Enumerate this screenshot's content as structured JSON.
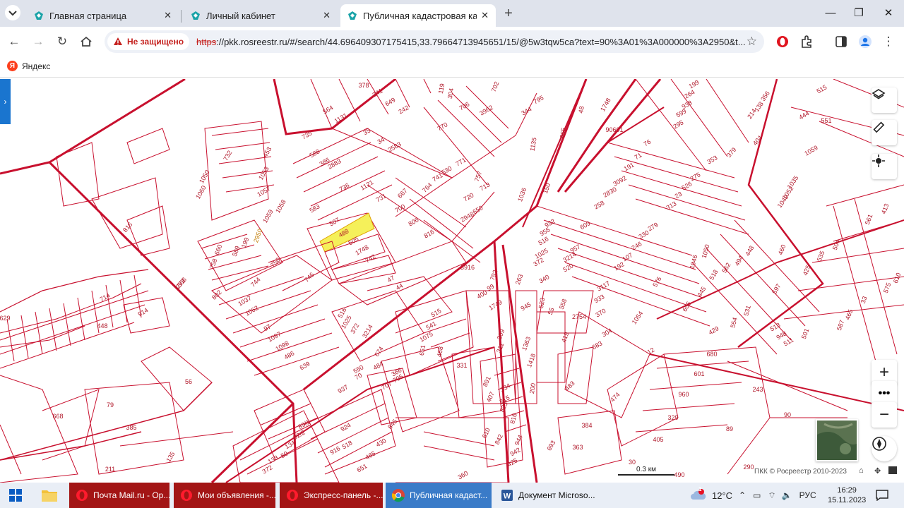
{
  "browser": {
    "tabs": [
      {
        "title": "Главная страница",
        "active": false
      },
      {
        "title": "Личный кабинет",
        "active": false
      },
      {
        "title": "Публичная кадастровая карта",
        "active": true
      }
    ],
    "new_tab_icon": "plus-icon",
    "security_label": "Не защищено",
    "url_scheme": "https",
    "url_rest": "://pkk.rosreestr.ru/#/search/44.696409307175415,33.79664713945651/15/@5w3tqw5ca?text=90%3A01%3A000000%3A2950&t...",
    "bookmark": "Яндекс"
  },
  "map": {
    "parcel_labels": [
      "378",
      "241",
      "649",
      "242",
      "35",
      "34",
      "2583",
      "1131",
      "386",
      "2883",
      "588",
      "735",
      "564",
      "119",
      "304",
      "706",
      "702",
      "3962",
      "770",
      "795",
      "344",
      "1135",
      "965",
      "48",
      "1748",
      "90601",
      "199",
      "264",
      "938",
      "599",
      "295",
      "353",
      "275",
      "526",
      "23",
      "313",
      "76",
      "71",
      "191",
      "3092",
      "2830",
      "258",
      "279",
      "330",
      "246",
      "107",
      "192",
      "3117",
      "933",
      "370",
      "1054",
      "1059",
      "1035",
      "1052",
      "1049",
      "404",
      "379",
      "214",
      "138",
      "356",
      "515",
      "444",
      "551",
      "561",
      "413",
      "504",
      "535",
      "425",
      "460",
      "448",
      "494",
      "562",
      "518",
      "445",
      "655",
      "1046",
      "1050",
      "597",
      "531",
      "554",
      "513",
      "948",
      "511",
      "429",
      "501",
      "587",
      "465",
      "33",
      "575",
      "610",
      "576",
      "453",
      "1053",
      "732",
      "1050",
      "1060",
      "1057",
      "1058",
      "1059",
      "583",
      "736",
      "1121",
      "731",
      "667",
      "700",
      "764",
      "741",
      "530",
      "771",
      "757",
      "713",
      "720",
      "650",
      "2948",
      "806",
      "816",
      "1036",
      "150",
      "507",
      "488",
      "505",
      "1748",
      "742",
      "2950",
      "199",
      "589",
      "660",
      "758",
      "750",
      "744",
      "1037",
      "1062",
      "802",
      "746",
      "47",
      "44",
      "3916",
      "792",
      "99",
      "400",
      "1749",
      "263",
      "945",
      "523",
      "558",
      "55",
      "419",
      "2754",
      "304",
      "683",
      "932",
      "609",
      "955",
      "516",
      "957",
      "1025",
      "372",
      "3214",
      "520",
      "340",
      "516",
      "1025",
      "372",
      "3214",
      "97",
      "1097",
      "1098",
      "486",
      "639",
      "515",
      "541",
      "1075",
      "651",
      "468",
      "674",
      "484",
      "550",
      "70",
      "366",
      "705",
      "707",
      "331",
      "309",
      "311",
      "1363",
      "1418",
      "200",
      "483",
      "474",
      "12",
      "680",
      "601",
      "960",
      "329",
      "405",
      "243",
      "89",
      "90",
      "384",
      "363",
      "693",
      "30",
      "490",
      "290",
      "56",
      "79",
      "385",
      "211",
      "668",
      "135",
      "89/1",
      "92/2",
      "134",
      "80",
      "133",
      "372",
      "937",
      "924",
      "518",
      "916",
      "845",
      "430",
      "465",
      "651",
      "891",
      "407",
      "334",
      "815",
      "825",
      "816",
      "610",
      "842",
      "944",
      "942",
      "425",
      "360",
      "816",
      "273",
      "1368",
      "914",
      "448",
      "629",
      "714",
      "1107",
      "714",
      "362",
      "363",
      "34",
      "35"
    ],
    "highlighted_parcel": "2950",
    "scale_label": "0.3 км",
    "copyright": "ПКК © Росреестр 2010-2023",
    "controls": [
      "layers-icon",
      "ruler-icon",
      "locate-icon",
      "zoom-in-icon",
      "more-icon",
      "zoom-out-icon",
      "compass-icon"
    ]
  },
  "taskbar": {
    "items": [
      {
        "label": "Почта Mail.ru - Ор...",
        "app": "opera"
      },
      {
        "label": "Мои объявления -...",
        "app": "opera"
      },
      {
        "label": "Экспресс-панель -...",
        "app": "opera"
      },
      {
        "label": "Публичная кадаст...",
        "app": "chrome"
      },
      {
        "label": "Документ Microso...",
        "app": "word"
      }
    ],
    "weather": "12°C",
    "weather_badge": "1",
    "language": "РУС",
    "time": "16:29",
    "date": "15.11.2023"
  },
  "colors": {
    "parcel_line": "#c8102e",
    "highlight_fill": "#f5f05a",
    "accent": "#1a75cf"
  }
}
